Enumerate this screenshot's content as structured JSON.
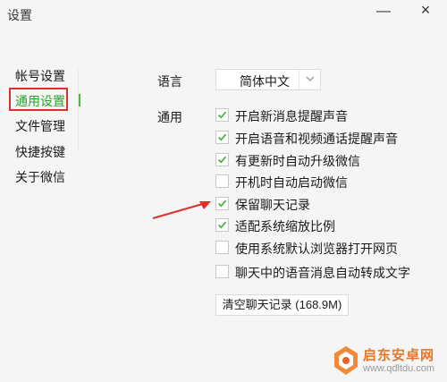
{
  "window": {
    "title": "设置"
  },
  "nav": {
    "items": [
      {
        "label": "帐号设置",
        "active": false
      },
      {
        "label": "通用设置",
        "active": true
      },
      {
        "label": "文件管理",
        "active": false
      },
      {
        "label": "快捷按键",
        "active": false
      },
      {
        "label": "关于微信",
        "active": false
      }
    ]
  },
  "general": {
    "language_label": "语言",
    "language_value": "简体中文",
    "general_label": "通用",
    "options": [
      {
        "label": "开启新消息提醒声音",
        "checked": true
      },
      {
        "label": "开启语音和视频通话提醒声音",
        "checked": true
      },
      {
        "label": "有更新时自动升级微信",
        "checked": true
      },
      {
        "label": "开机时自动启动微信",
        "checked": false
      },
      {
        "label": "保留聊天记录",
        "checked": true
      },
      {
        "label": "适配系统缩放比例",
        "checked": true
      },
      {
        "label": "使用系统默认浏览器打开网页",
        "checked": false
      },
      {
        "label": "聊天中的语音消息自动转成文字",
        "checked": false
      }
    ],
    "clear_button": "清空聊天记录 (168.9M)"
  },
  "watermark": {
    "name": "启东安卓网",
    "url": "www.qdltdu.com"
  },
  "colors": {
    "active": "#2aa32a",
    "check": "#3fae3f",
    "highlight": "#e0302c",
    "arrow": "#e0302c"
  }
}
